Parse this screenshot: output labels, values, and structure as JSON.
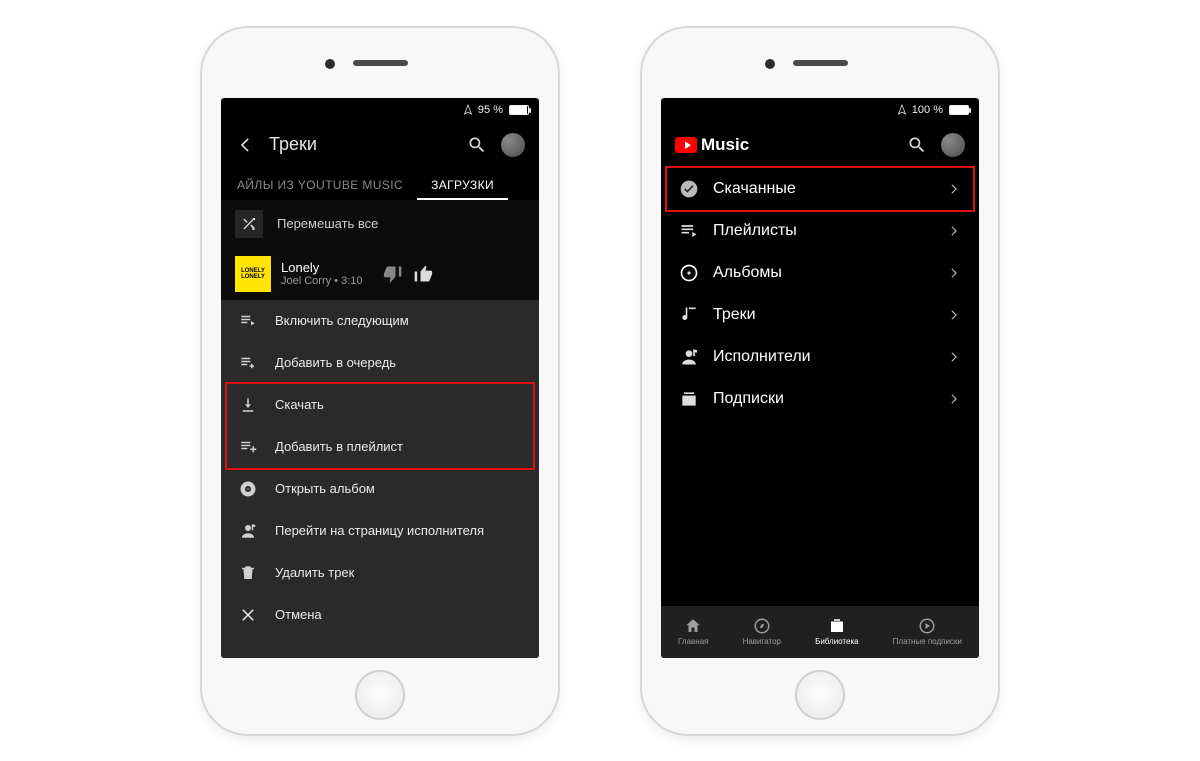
{
  "screen1": {
    "status": {
      "battery_text": "95 %",
      "battery_fill_pct": 95
    },
    "header": {
      "title": "Треки"
    },
    "tabs": [
      {
        "label": "АЙЛЫ ИЗ YOUTUBE MUSIC",
        "active": false
      },
      {
        "label": "ЗАГРУЗКИ",
        "active": true
      }
    ],
    "shuffle_label": "Перемешать все",
    "track": {
      "title": "Lonely",
      "subtitle": "Joel Corry • 3:10",
      "art_text": "LONELY"
    },
    "sheet_items": [
      {
        "icon": "queue-next-icon",
        "label": "Включить следующим"
      },
      {
        "icon": "queue-add-icon",
        "label": "Добавить в очередь"
      },
      {
        "icon": "download-icon",
        "label": "Скачать"
      },
      {
        "icon": "playlist-add-icon",
        "label": "Добавить в плейлист"
      },
      {
        "icon": "album-icon",
        "label": "Открыть альбом"
      },
      {
        "icon": "artist-icon",
        "label": "Перейти на страницу исполнителя"
      },
      {
        "icon": "trash-icon",
        "label": "Удалить трек"
      },
      {
        "icon": "close-icon",
        "label": "Отмена"
      }
    ],
    "highlight": {
      "start_index": 2,
      "end_index": 3
    }
  },
  "screen2": {
    "status": {
      "battery_text": "100 %",
      "battery_fill_pct": 100
    },
    "logo_text": "Music",
    "library_items": [
      {
        "icon": "downloaded-icon",
        "label": "Скачанные",
        "highlight": true
      },
      {
        "icon": "playlist-icon",
        "label": "Плейлисты"
      },
      {
        "icon": "album-disc-icon",
        "label": "Альбомы"
      },
      {
        "icon": "note-icon",
        "label": "Треки"
      },
      {
        "icon": "artist-icon",
        "label": "Исполнители"
      },
      {
        "icon": "subs-icon",
        "label": "Подписки"
      }
    ],
    "bottom_nav": [
      {
        "icon": "home-icon",
        "label": "Главная"
      },
      {
        "icon": "compass-icon",
        "label": "Навигатор"
      },
      {
        "icon": "library-icon",
        "label": "Библиотека",
        "active": true
      },
      {
        "icon": "paid-icon",
        "label": "Платные подписки"
      }
    ]
  }
}
